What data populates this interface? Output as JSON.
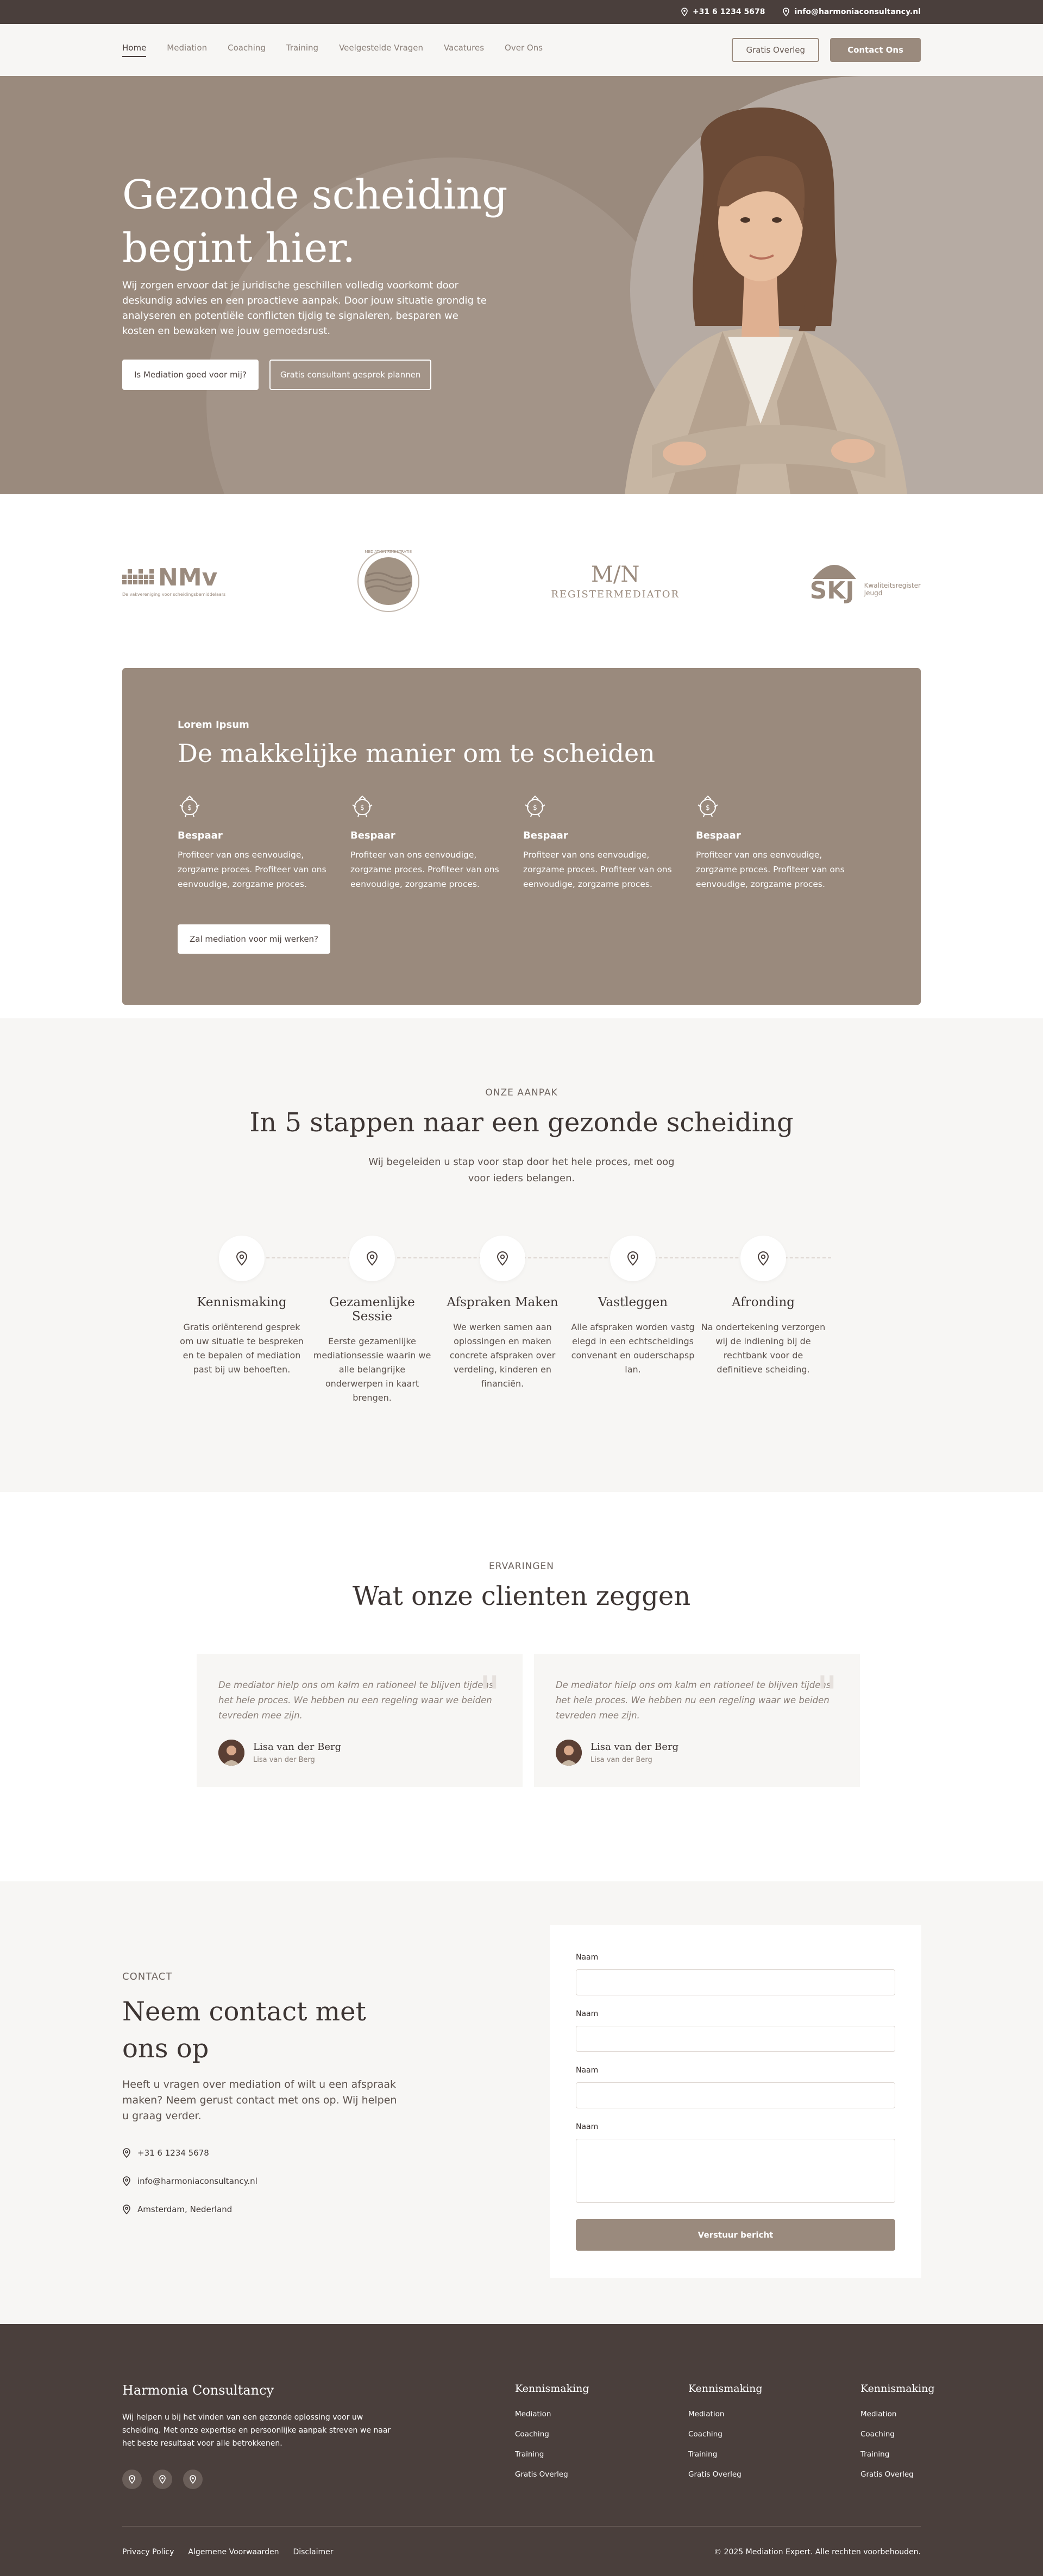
{
  "topbar": {
    "phone": "+31 6 1234 5678",
    "email": "info@harmoniaconsultancy.nl"
  },
  "nav": {
    "links": [
      "Home",
      "Mediation",
      "Coaching",
      "Training",
      "Veelgestelde Vragen",
      "Vacatures",
      "Over Ons"
    ],
    "active": "Home",
    "cta_outline": "Gratis Overleg",
    "cta_solid": "Contact Ons"
  },
  "hero": {
    "title": "Gezonde scheiding begint hier.",
    "text": "Wij zorgen ervoor dat je juridische geschillen volledig voorkomt door deskundig advies en een proactieve aanpak. Door jouw situatie grondig te analyseren en potentiële conflicten tijdig te signaleren, besparen we kosten en bewaken we jouw gemoedsrust.",
    "btn_primary": "Is Mediation goed voor mij?",
    "btn_secondary": "Gratis consultant gesprek plannen"
  },
  "logos": {
    "nmv": "NMv",
    "nmv_sub": "De vakvereniging voor scheidingsbemiddelaars",
    "seal": "MEDIATION REGISTRATIE",
    "mfn_mark": "M/N",
    "mfn_text": "REGISTERMEDIATOR",
    "skj": "SKJ",
    "skj_sub1": "Kwaliteitsregister",
    "skj_sub2": "Jeugd"
  },
  "features": {
    "eyebrow": "Lorem Ipsum",
    "title": "De makkelijke manier om te scheiden",
    "items": [
      {
        "title": "Bespaar",
        "text": "Profiteer van ons eenvoudige, zorgzame proces. Profiteer van ons eenvoudige, zorgzame proces."
      },
      {
        "title": "Bespaar",
        "text": "Profiteer van ons eenvoudige, zorgzame proces. Profiteer van ons eenvoudige, zorgzame proces."
      },
      {
        "title": "Bespaar",
        "text": "Profiteer van ons eenvoudige, zorgzame proces. Profiteer van ons eenvoudige, zorgzame proces."
      },
      {
        "title": "Bespaar",
        "text": "Profiteer van ons eenvoudige, zorgzame proces. Profiteer van ons eenvoudige, zorgzame proces."
      }
    ],
    "button": "Zal mediation voor mij werken?"
  },
  "steps": {
    "eyebrow": "ONZE AANPAK",
    "title": "In 5 stappen naar een gezonde scheiding",
    "subtitle": "Wij begeleiden u stap voor stap door het hele proces, met oog voor ieders belangen.",
    "items": [
      {
        "title": "Kennismaking",
        "text": "Gratis oriënterend gesprek om uw situatie te bespreken en te bepalen of mediation past bij uw behoeften."
      },
      {
        "title": "Gezamenlijke Sessie",
        "text": "Eerste gezamenlijke mediationsessie waarin we alle belangrijke onderwerpen in kaart brengen."
      },
      {
        "title": "Afspraken Maken",
        "text": "We werken samen aan oplossingen en maken concrete afspraken over verdeling, kinderen en financiën."
      },
      {
        "title": "Vastleggen",
        "text": "Alle afspraken worden vastgelegd in een echtscheidingsconvenant en ouderschapsplan."
      },
      {
        "title": "Afronding",
        "text": "Na ondertekening verzorgen wij de indiening bij de rechtbank voor de definitieve scheiding."
      }
    ]
  },
  "testimonials": {
    "eyebrow": "ERVARINGEN",
    "title": "Wat onze clienten zeggen",
    "items": [
      {
        "quote": "De mediator hielp ons om kalm en rationeel te blijven tijdens het hele proces. We hebben nu een regeling waar we beiden tevreden mee zijn.",
        "name": "Lisa van der Berg",
        "role": "Lisa van der Berg"
      },
      {
        "quote": "De mediator hielp ons om kalm en rationeel te blijven tijdens het hele proces. We hebben nu een regeling waar we beiden tevreden mee zijn.",
        "name": "Lisa van der Berg",
        "role": "Lisa van der Berg"
      }
    ]
  },
  "contact": {
    "eyebrow": "CONTACT",
    "title": "Neem contact met ons op",
    "text": "Heeft u vragen over mediation of wilt u een afspraak maken? Neem gerust contact met ons op. Wij helpen u graag verder.",
    "phone": "+31 6 1234 5678",
    "email": "info@harmoniaconsultancy.nl",
    "address": "Amsterdam, Nederland",
    "form": {
      "fields": [
        "Naam",
        "Naam",
        "Naam",
        "Naam"
      ],
      "submit": "Verstuur bericht"
    }
  },
  "footer": {
    "brand": "Harmonia Consultancy",
    "description": "Wij helpen u bij het vinden van een gezonde oplossing voor uw scheiding. Met onze expertise en persoonlijke aanpak streven we naar het beste resultaat voor alle betrokkenen.",
    "columns": [
      {
        "title": "Kennismaking",
        "links": [
          "Mediation",
          "Coaching",
          "Training",
          "Gratis Overleg"
        ]
      },
      {
        "title": "Kennismaking",
        "links": [
          "Mediation",
          "Coaching",
          "Training",
          "Gratis Overleg"
        ]
      },
      {
        "title": "Kennismaking",
        "links": [
          "Mediation",
          "Coaching",
          "Training",
          "Gratis Overleg"
        ]
      }
    ],
    "bottom_links": [
      "Privacy Policy",
      "Algemene Voorwaarden",
      "Disclaimer"
    ],
    "copyright": "© 2025 Mediation Expert. Alle rechten voorbehouden."
  },
  "colors": {
    "brand": "#9a8a7d",
    "dark": "#4a3f3c",
    "light_bg": "#f7f6f4"
  }
}
